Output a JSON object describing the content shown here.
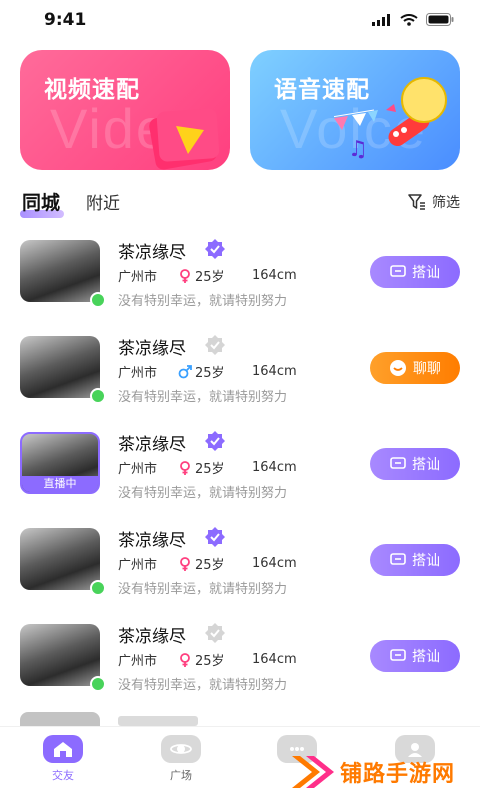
{
  "status": {
    "time": "9:41"
  },
  "banners": {
    "video": {
      "title": "视频速配",
      "watermark": "Video"
    },
    "voice": {
      "title": "语音速配",
      "watermark": "Voice"
    }
  },
  "tabs": {
    "active": "同城",
    "other": "附近",
    "filter": "筛选"
  },
  "users": [
    {
      "name": "茶凉缘尽",
      "city": "广州市",
      "gender": "female",
      "age": "25岁",
      "height": "164cm",
      "bio": "没有特别幸运，就请特别努力",
      "verified": true,
      "live": false,
      "action": "搭讪"
    },
    {
      "name": "茶凉缘尽",
      "city": "广州市",
      "gender": "male",
      "age": "25岁",
      "height": "164cm",
      "bio": "没有特别幸运，就请特别努力",
      "verified": false,
      "live": false,
      "action": "聊聊"
    },
    {
      "name": "茶凉缘尽",
      "city": "广州市",
      "gender": "female",
      "age": "25岁",
      "height": "164cm",
      "bio": "没有特别幸运，就请特别努力",
      "verified": true,
      "live": true,
      "live_label": "直播中",
      "action": "搭讪"
    },
    {
      "name": "茶凉缘尽",
      "city": "广州市",
      "gender": "female",
      "age": "25岁",
      "height": "164cm",
      "bio": "没有特别幸运，就请特别努力",
      "verified": true,
      "live": false,
      "action": "搭讪"
    },
    {
      "name": "茶凉缘尽",
      "city": "广州市",
      "gender": "female",
      "age": "25岁",
      "height": "164cm",
      "bio": "没有特别幸运，就请特别努力",
      "verified": false,
      "live": false,
      "action": "搭讪"
    }
  ],
  "nav": [
    {
      "label": "交友",
      "icon": "home-icon",
      "active": true
    },
    {
      "label": "广场",
      "icon": "planet-icon",
      "active": false
    },
    {
      "label": "",
      "icon": "message-icon",
      "active": false
    },
    {
      "label": "",
      "icon": "profile-icon",
      "active": false
    }
  ],
  "watermark": {
    "text": "铺路手游网"
  },
  "colors": {
    "accent": "#8c6bff",
    "orange": "#ff7d00",
    "pink": "#ff3f7f",
    "blue": "#4a8dff",
    "online": "#48d35a"
  }
}
